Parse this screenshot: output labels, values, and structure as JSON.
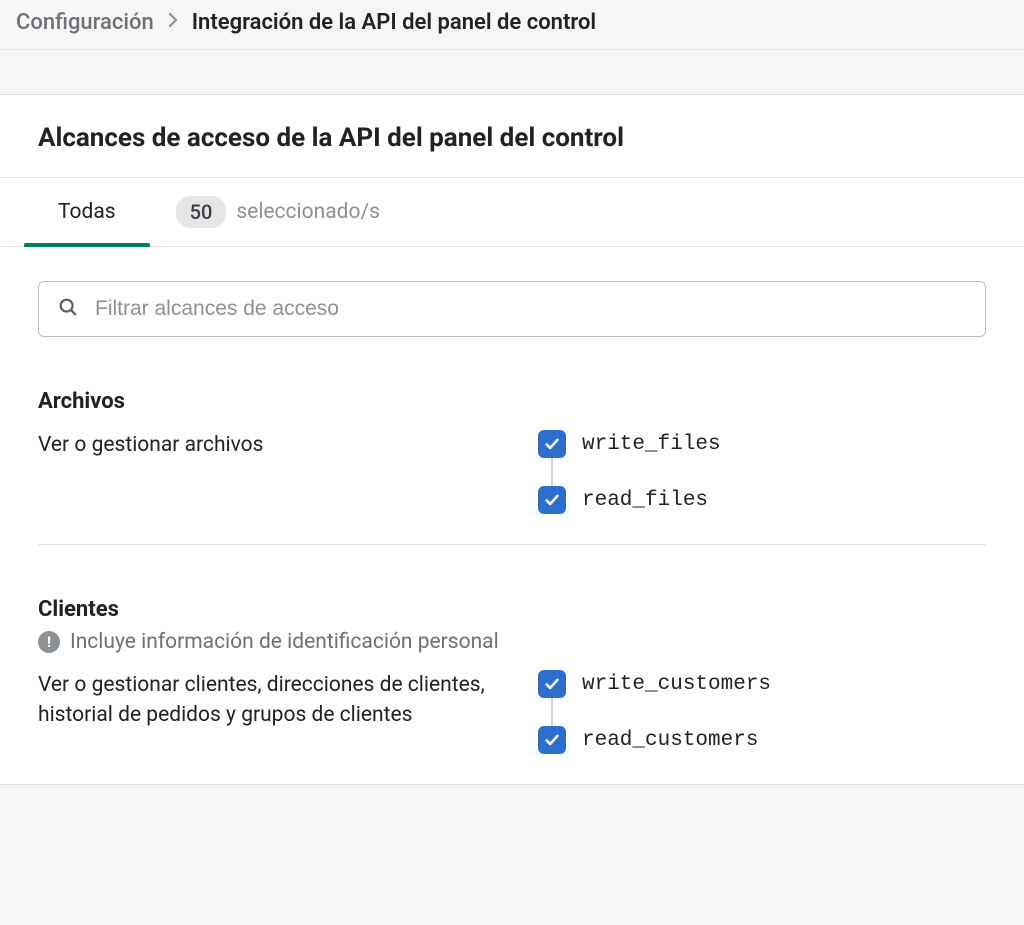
{
  "breadcrumb": {
    "parent": "Configuración",
    "current": "Integración de la API del panel de control"
  },
  "panel": {
    "title": "Alcances de acceso de la API del panel del control"
  },
  "tabs": {
    "all_label": "Todas",
    "selected_count": "50",
    "selected_label": "seleccionado/s"
  },
  "search": {
    "placeholder": "Filtrar alcances de acceso"
  },
  "sections": [
    {
      "title": "Archivos",
      "pii_notice": null,
      "description": "Ver o gestionar archivos",
      "scopes": [
        "write_files",
        "read_files"
      ]
    },
    {
      "title": "Clientes",
      "pii_notice": "Incluye información de identificación personal",
      "description": "Ver o gestionar clientes, direcciones de clientes, historial de pedidos y grupos de clientes",
      "scopes": [
        "write_customers",
        "read_customers"
      ]
    }
  ]
}
